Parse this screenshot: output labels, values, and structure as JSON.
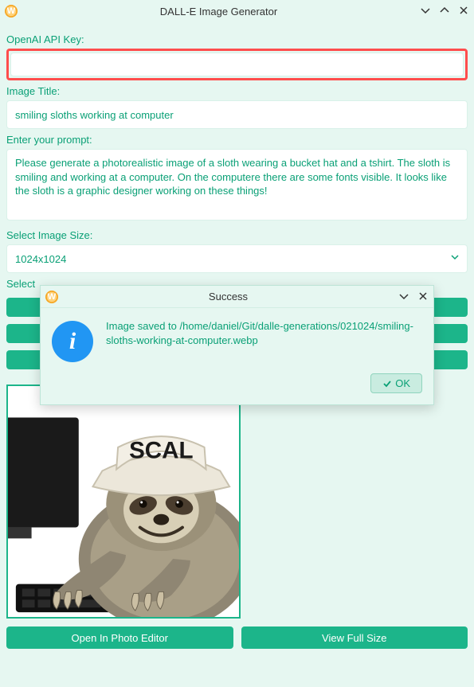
{
  "window": {
    "title": "DALL-E Image Generator",
    "app_icon_letter": "W"
  },
  "labels": {
    "api_key": "OpenAI API Key:",
    "image_title": "Image Title:",
    "prompt": "Enter your prompt:",
    "image_size": "Select Image Size:",
    "select_partial": "Select"
  },
  "inputs": {
    "api_key_value": "",
    "image_title_value": "smiling sloths working at computer",
    "prompt_value": "Please generate a photorealistic image of a sloth wearing a bucket hat and a tshirt. The sloth is smiling and working at a computer. On the computere there are some fonts visible. It looks like the sloth is a graphic designer working on these things!",
    "size_value": "1024x1024"
  },
  "buttons": {
    "open_editor": "Open In Photo Editor",
    "view_full": "View Full Size"
  },
  "dialog": {
    "title": "Success",
    "message": "Image saved to /home/daniel/Git/dalle-generations/021024/smiling-sloths-working-at-computer.webp",
    "ok": "OK",
    "app_icon_letter": "W"
  },
  "image": {
    "hat_text": "SCAL"
  }
}
